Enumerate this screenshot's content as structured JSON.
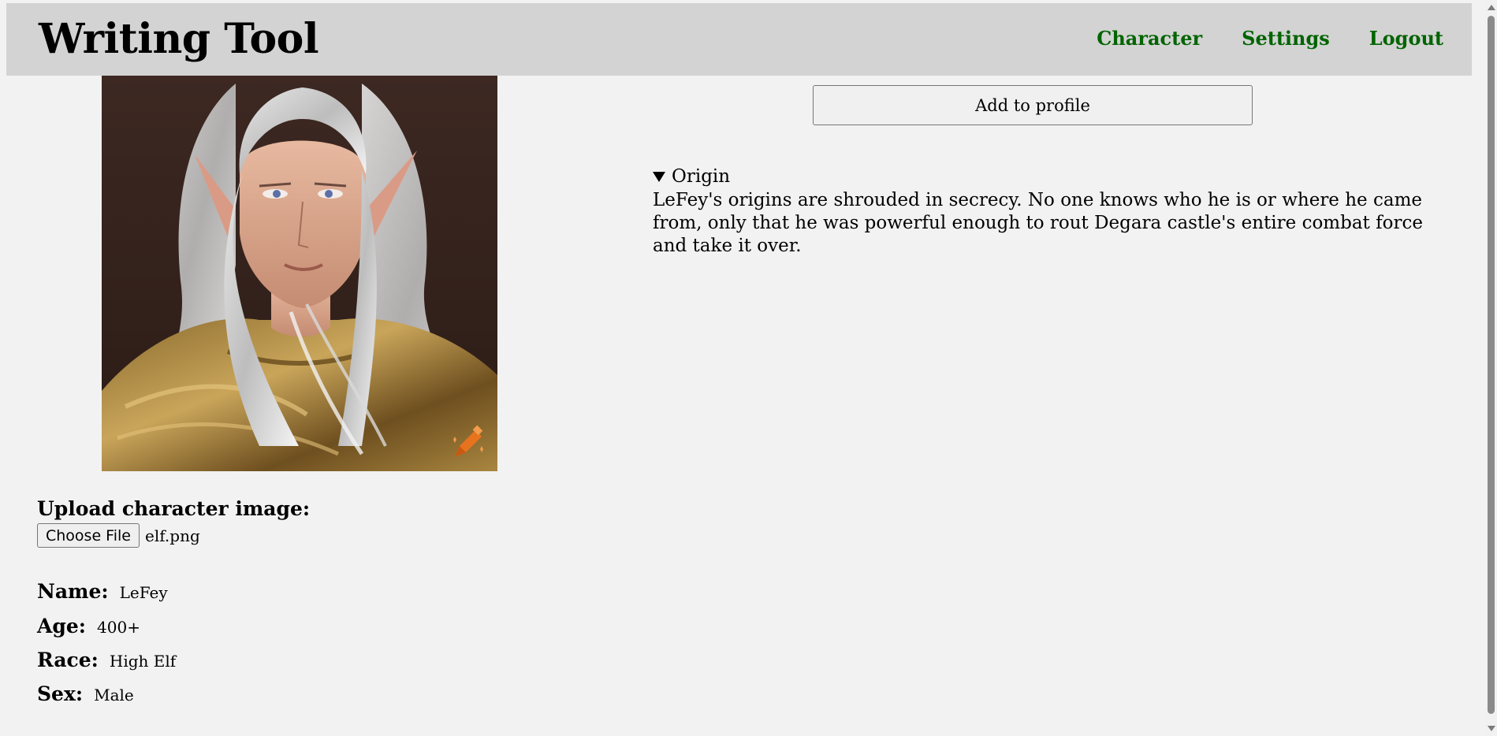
{
  "header": {
    "title": "Writing Tool",
    "nav": [
      "Character",
      "Settings",
      "Logout"
    ]
  },
  "actions": {
    "add_to_profile": "Add to profile"
  },
  "upload": {
    "label": "Upload character image:",
    "button": "Choose File",
    "file_name": "elf.png"
  },
  "character": {
    "fields": [
      {
        "label": "Name:",
        "value": "LeFey"
      },
      {
        "label": "Age:",
        "value": "400+"
      },
      {
        "label": "Race:",
        "value": "High Elf"
      },
      {
        "label": "Sex:",
        "value": "Male"
      }
    ]
  },
  "origin": {
    "summary": "Origin",
    "text": "LeFey's origins are shrouded in secrecy. No one knows who he is or where he came from, only that he was powerful enough to rout Degara castle's entire combat force and take it over."
  },
  "colors": {
    "nav_link": "#006400",
    "header_bg": "#d3d3d3",
    "page_bg": "#f2f2f2"
  },
  "icons": {
    "portrait_badge": "crayon-sparkle-icon",
    "details_toggle": "triangle-down-icon"
  }
}
